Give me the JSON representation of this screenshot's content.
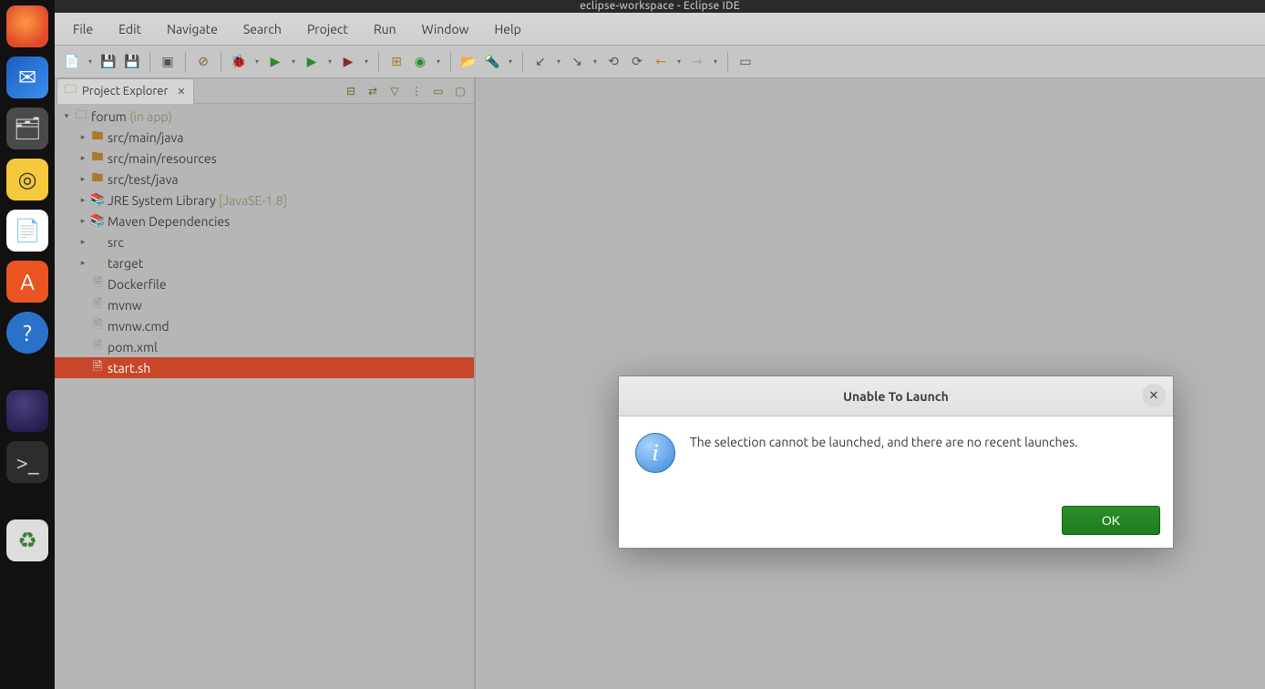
{
  "window_title": "eclipse-workspace - Eclipse IDE",
  "menubar": [
    "File",
    "Edit",
    "Navigate",
    "Search",
    "Project",
    "Run",
    "Window",
    "Help"
  ],
  "view": {
    "title": "Project Explorer"
  },
  "tree": {
    "root": {
      "name": "forum",
      "qualifier": "(in app)"
    },
    "children": [
      {
        "name": "src/main/java",
        "kind": "pkgfolder",
        "expandable": true
      },
      {
        "name": "src/main/resources",
        "kind": "pkgfolder",
        "expandable": true
      },
      {
        "name": "src/test/java",
        "kind": "pkgfolder",
        "expandable": true
      },
      {
        "name": "JRE System Library",
        "qualifier": "[JavaSE-1.8]",
        "kind": "lib",
        "expandable": true
      },
      {
        "name": "Maven Dependencies",
        "kind": "lib",
        "expandable": true
      },
      {
        "name": "src",
        "kind": "folder",
        "expandable": true
      },
      {
        "name": "target",
        "kind": "folder",
        "expandable": true
      },
      {
        "name": "Dockerfile",
        "kind": "file",
        "expandable": false
      },
      {
        "name": "mvnw",
        "kind": "file",
        "expandable": false
      },
      {
        "name": "mvnw.cmd",
        "kind": "file",
        "expandable": false
      },
      {
        "name": "pom.xml",
        "kind": "file",
        "expandable": false
      },
      {
        "name": "start.sh",
        "kind": "file",
        "expandable": false,
        "selected": true
      }
    ]
  },
  "dialog": {
    "title": "Unable To Launch",
    "message": "The selection cannot be launched, and there are no recent launches.",
    "ok": "OK"
  },
  "dock": {
    "firefox": "Firefox",
    "thunderbird": "Thunderbird",
    "files": "Files",
    "rhythmbox": "Rhythmbox",
    "writer": "LibreOffice Writer",
    "software": "Ubuntu Software",
    "help": "Help",
    "eclipse": "Eclipse",
    "terminal": "Terminal",
    "trash": "Trash"
  }
}
